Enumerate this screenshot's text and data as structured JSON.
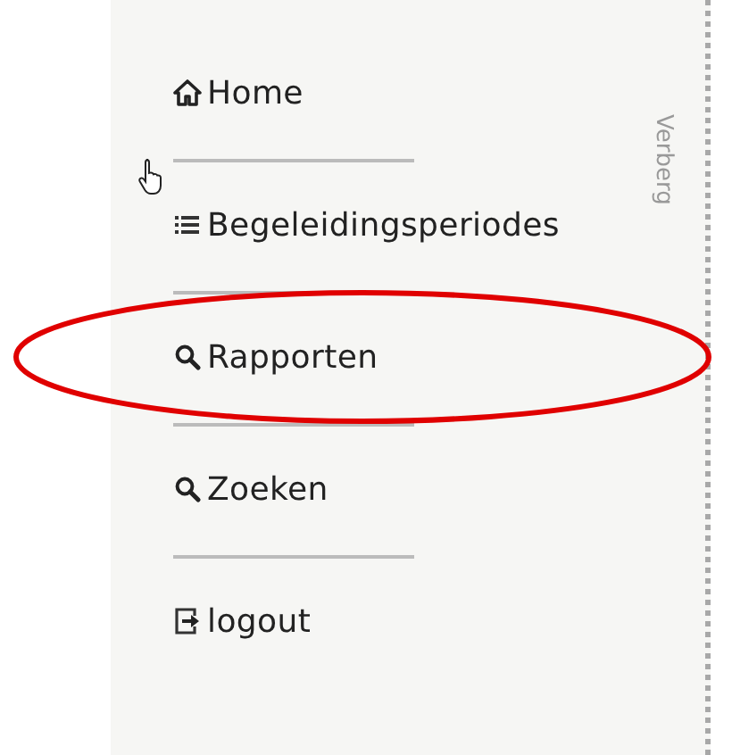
{
  "menu": [
    {
      "label": "Home",
      "kind": "home",
      "circled": false
    },
    {
      "label": "Begeleidingsperiodes",
      "kind": "list",
      "circled": false
    },
    {
      "label": "Rapporten",
      "kind": "search",
      "circled": true
    },
    {
      "label": "Zoeken",
      "kind": "search",
      "circled": false
    },
    {
      "label": "logout",
      "kind": "logout",
      "circled": false
    }
  ],
  "hide_tab": {
    "label": "Verberg"
  }
}
